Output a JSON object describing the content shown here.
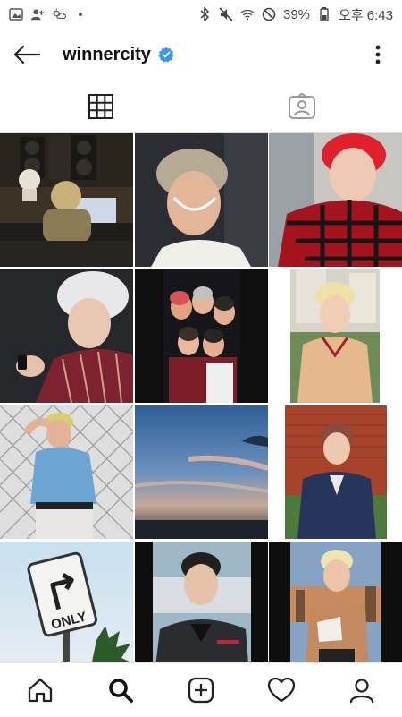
{
  "status_bar": {
    "battery_percent": "39%",
    "clock": "오후 6:43",
    "left_icons": [
      "image-icon",
      "person-add-icon",
      "weather-icon",
      "dot-icon"
    ],
    "right_icons": [
      "bluetooth-icon",
      "mute-icon",
      "wifi-icon",
      "do-not-disturb-icon",
      "battery-icon"
    ]
  },
  "header": {
    "username": "winnercity",
    "verified": true,
    "accent_color": "#3897f0"
  },
  "tabs": {
    "items": [
      {
        "icon": "grid-icon",
        "active": true
      },
      {
        "icon": "tagged-icon",
        "active": false
      }
    ]
  },
  "grid": {
    "posts": [
      {
        "name": "studio-mixing-desk"
      },
      {
        "name": "silver-hair-smile"
      },
      {
        "name": "red-hair-plaid"
      },
      {
        "name": "white-hair-burgundy-suit"
      },
      {
        "name": "group-photo"
      },
      {
        "name": "blonde-sweater"
      },
      {
        "name": "denim-shirt-fence"
      },
      {
        "name": "sky-sunset"
      },
      {
        "name": "navy-jacket-brick"
      },
      {
        "name": "only-road-sign"
      },
      {
        "name": "leather-jacket-portrait"
      },
      {
        "name": "blonde-rooftop-city"
      }
    ]
  },
  "sign": {
    "text": "ONLY"
  },
  "bottom_nav": {
    "items": [
      {
        "icon": "home-icon",
        "active": false
      },
      {
        "icon": "search-icon",
        "active": true
      },
      {
        "icon": "add-post-icon",
        "active": false
      },
      {
        "icon": "heart-icon",
        "active": false
      },
      {
        "icon": "profile-icon",
        "active": false
      }
    ]
  }
}
